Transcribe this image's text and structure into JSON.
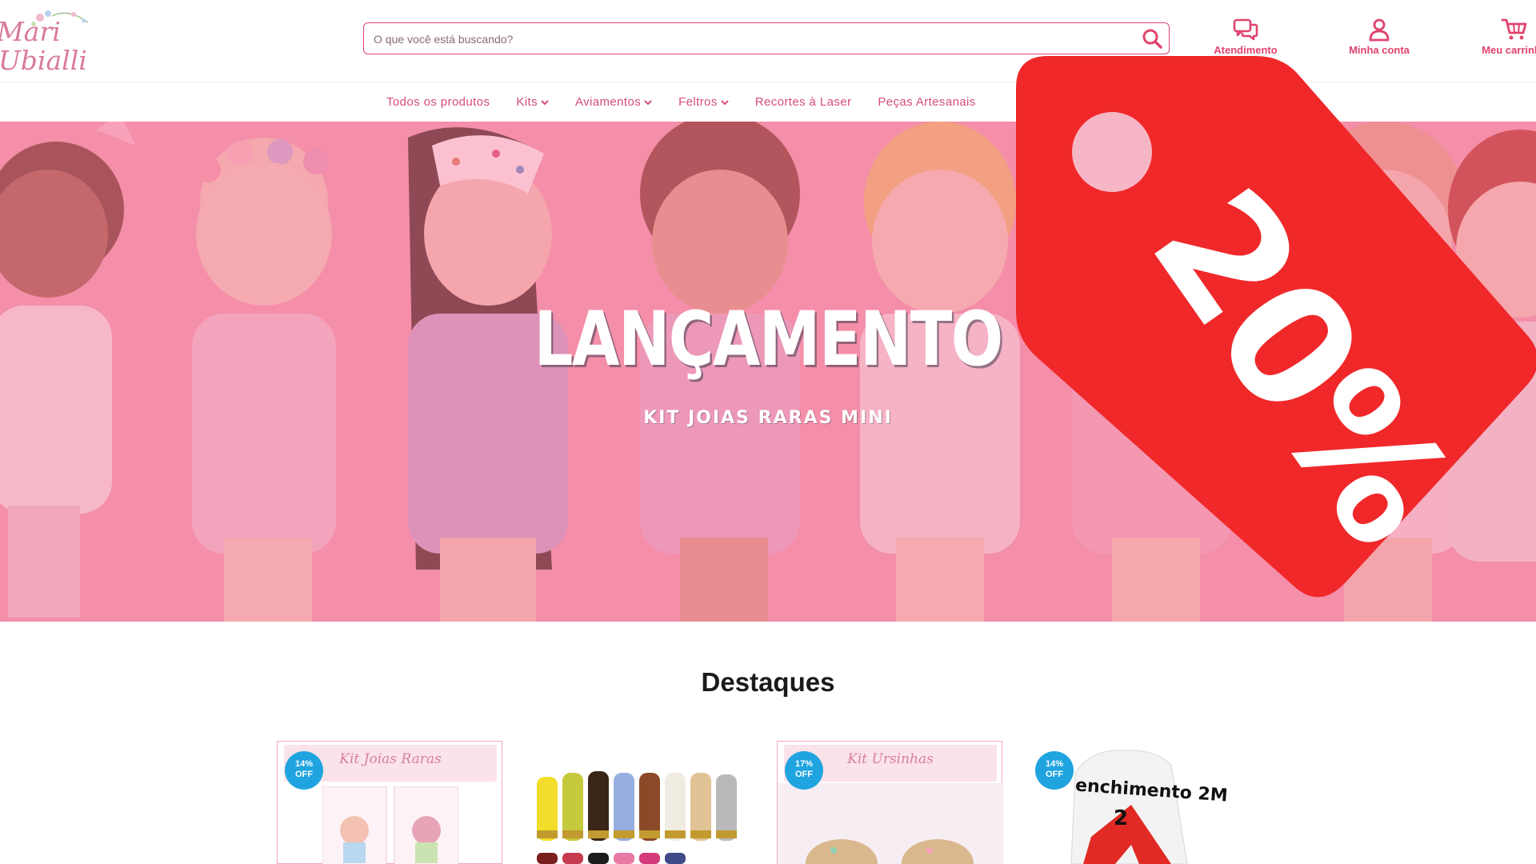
{
  "header": {
    "logo_line1": "Mari",
    "logo_line2": "Ubialli",
    "search_placeholder": "O que você está buscando?",
    "actions": [
      {
        "label": "Atendimento",
        "icon": "chat-icon"
      },
      {
        "label": "Minha conta",
        "icon": "user-icon"
      },
      {
        "label": "Meu carrinho",
        "icon": "cart-icon"
      }
    ]
  },
  "nav": {
    "items": [
      {
        "label": "Todos os produtos",
        "has_dropdown": false
      },
      {
        "label": "Kits",
        "has_dropdown": true
      },
      {
        "label": "Aviamentos",
        "has_dropdown": true
      },
      {
        "label": "Feltros",
        "has_dropdown": true
      },
      {
        "label": "Recortes à Laser",
        "has_dropdown": false
      },
      {
        "label": "Peças Artesanais",
        "has_dropdown": false
      }
    ]
  },
  "banner": {
    "title": "LANÇAMENTO",
    "subtitle": "KIT JOIAS RARAS MINI"
  },
  "promo_tag": {
    "text": "20%",
    "color": "#f0282a"
  },
  "featured": {
    "title": "Destaques",
    "products": [
      {
        "badge_pct": "14%",
        "badge_off": "OFF",
        "image_title": "Kit Joias Raras"
      },
      {
        "badge_pct": "",
        "badge_off": "",
        "image_title": ""
      },
      {
        "badge_pct": "17%",
        "badge_off": "OFF",
        "image_title": "Kit Ursinhas"
      },
      {
        "badge_pct": "14%",
        "badge_off": "OFF",
        "image_title": "enchimento 2M"
      }
    ]
  },
  "colors": {
    "brand_pink": "#e0436d",
    "nav_pink": "#d44d77",
    "badge_blue": "#1fa4e0"
  }
}
